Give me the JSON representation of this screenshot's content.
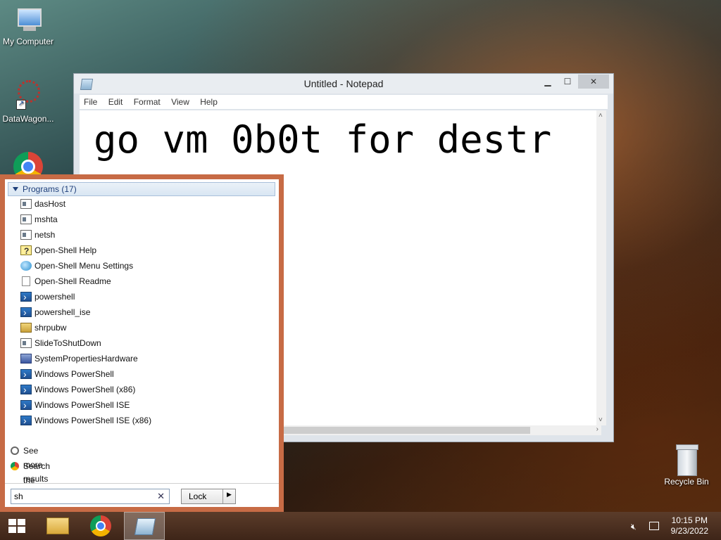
{
  "desktop": {
    "icons": [
      {
        "label": "My Computer"
      },
      {
        "label": "DataWagon..."
      },
      {
        "label": "Recycle Bin"
      }
    ]
  },
  "notepad": {
    "title": "Untitled - Notepad",
    "menu": [
      "File",
      "Edit",
      "Format",
      "View",
      "Help"
    ],
    "content": "go vm 0b0t for destr"
  },
  "startmenu": {
    "programs_header": "Programs (17)",
    "programs": [
      {
        "label": "dasHost",
        "icon": "window-icon"
      },
      {
        "label": "mshta",
        "icon": "window-icon"
      },
      {
        "label": "netsh",
        "icon": "window-icon"
      },
      {
        "label": "Open-Shell Help",
        "icon": "help-icon"
      },
      {
        "label": "Open-Shell Menu Settings",
        "icon": "globe-icon"
      },
      {
        "label": "Open-Shell Readme",
        "icon": "document-icon"
      },
      {
        "label": "powershell",
        "icon": "powershell-icon"
      },
      {
        "label": "powershell_ise",
        "icon": "powershell-icon"
      },
      {
        "label": "shrpubw",
        "icon": "share-icon"
      },
      {
        "label": "SlideToShutDown",
        "icon": "window-icon"
      },
      {
        "label": "SystemPropertiesHardware",
        "icon": "system-icon"
      },
      {
        "label": "Windows PowerShell",
        "icon": "powershell-icon"
      },
      {
        "label": "Windows PowerShell (x86)",
        "icon": "powershell-icon"
      },
      {
        "label": "Windows PowerShell ISE",
        "icon": "powershell-icon"
      },
      {
        "label": "Windows PowerShell ISE (x86)",
        "icon": "powershell-icon"
      }
    ],
    "see_more": "See more results",
    "search_internet": "Search the Internet",
    "search_value": "sh",
    "lock_label": "Lock"
  },
  "taskbar": {
    "time": "10:15 PM",
    "date": "9/23/2022"
  },
  "colors": {
    "start_menu_border": "#c76b45",
    "taskbar": "#4a2e1f"
  }
}
